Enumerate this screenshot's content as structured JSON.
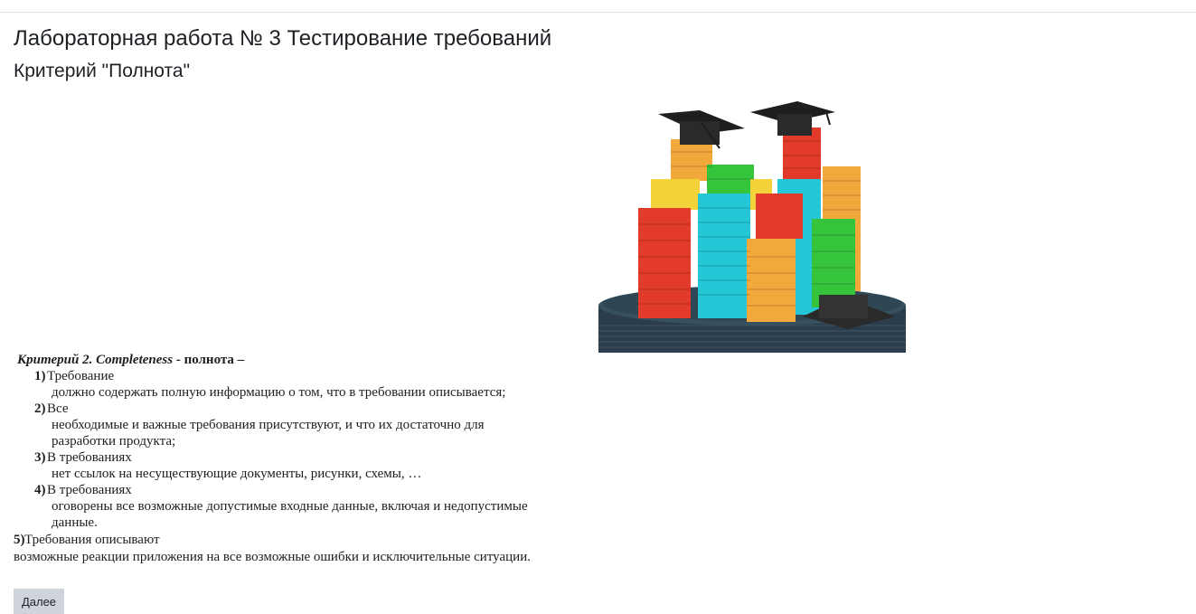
{
  "page": {
    "title": "Лабораторная работа № 3 Тестирование требований",
    "subtitle": "Критерий \"Полнота\""
  },
  "criterion": {
    "heading_italic": "Критерий 2. Completeness",
    "heading_rest": " - полнота –",
    "items": [
      {
        "number": "1)",
        "lead": "Требование",
        "lines": [
          "должно содержать полную информацию о том, что в требовании описывается;"
        ]
      },
      {
        "number": "2)",
        "lead": "Все",
        "lines": [
          "необходимые и важные требования присутствуют, и что их достаточно для",
          "разработки продукта;"
        ]
      },
      {
        "number": "3)",
        "lead": "В требованиях",
        "lines": [
          "нет ссылок на несуществующие документы, рисунки, схемы, …"
        ]
      },
      {
        "number": "4)",
        "lead": "В требованиях",
        "lines": [
          "оговорены все возможные допустимые входные данные, включая и недопустимые",
          "данные."
        ]
      }
    ],
    "item5": {
      "number": "5)",
      "lead": " Требования описывают",
      "line": "возможные реакции приложения на все возможные ошибки и исключительные ситуации."
    }
  },
  "navigation": {
    "next_label": "Далее"
  }
}
